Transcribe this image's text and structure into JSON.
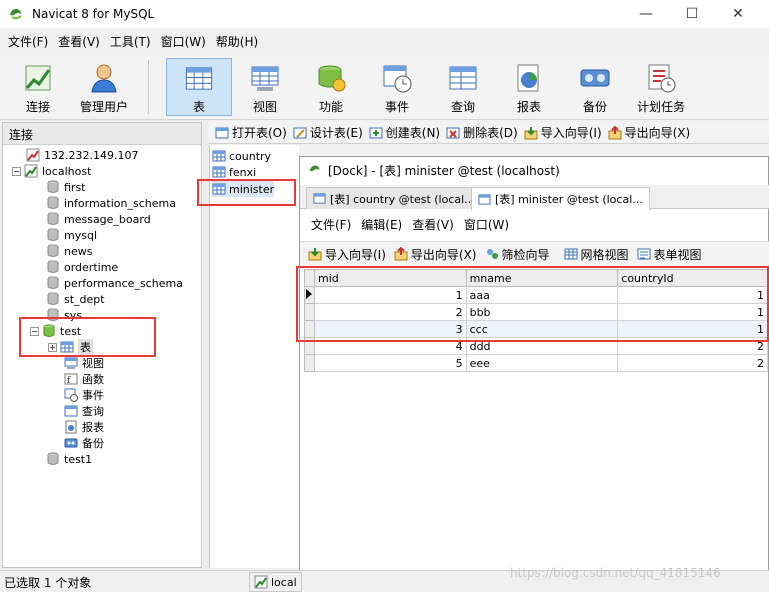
{
  "window": {
    "title": "Navicat 8 for MySQL",
    "minimize": "—",
    "maximize": "☐",
    "close": "✕"
  },
  "menu": [
    "文件(F)",
    "查看(V)",
    "工具(T)",
    "窗口(W)",
    "帮助(H)"
  ],
  "toolbar": [
    "连接",
    "管理用户",
    "表",
    "视图",
    "功能",
    "事件",
    "查询",
    "报表",
    "备份",
    "计划任务"
  ],
  "left_panel": {
    "header": "连接"
  },
  "tree": {
    "server": "132.232.149.107",
    "localhost": "localhost",
    "databases": [
      "first",
      "information_schema",
      "message_board",
      "mysql",
      "news",
      "ordertime",
      "performance_schema",
      "st_dept",
      "sys",
      "test"
    ],
    "test_children": [
      "表",
      "视图",
      "函数",
      "事件",
      "查询",
      "报表",
      "备份"
    ],
    "last_db": "test1"
  },
  "object_toolbar": [
    "打开表(O)",
    "设计表(E)",
    "创建表(N)",
    "删除表(D)",
    "导入向导(I)",
    "导出向导(X)"
  ],
  "tables": [
    "country",
    "fenxi",
    "minister"
  ],
  "dock": {
    "title": "[Dock] - [表] minister @test (localhost)",
    "tabs": [
      "[表] country @test (local...",
      "[表] minister @test (local..."
    ],
    "menu": [
      "文件(F)",
      "编辑(E)",
      "查看(V)",
      "窗口(W)"
    ],
    "toolbar": [
      "导入向导(I)",
      "导出向导(X)",
      "筛检向导",
      "网格视图",
      "表单视图"
    ]
  },
  "grid": {
    "columns": [
      "mid",
      "mname",
      "countryId"
    ],
    "rows": [
      [
        "1",
        "aaa",
        "1"
      ],
      [
        "2",
        "bbb",
        "1"
      ],
      [
        "3",
        "ccc",
        "1"
      ],
      [
        "4",
        "ddd",
        "2"
      ],
      [
        "5",
        "eee",
        "2"
      ]
    ]
  },
  "status": {
    "text": "已选取 1 个对象",
    "connection": "local"
  },
  "watermark": "https://blog.csdn.net/qq_41815146",
  "colors": {
    "highlight": "#e8393a",
    "active_toolbar": "#cde3f7",
    "selected_row": "#eef3fb"
  }
}
